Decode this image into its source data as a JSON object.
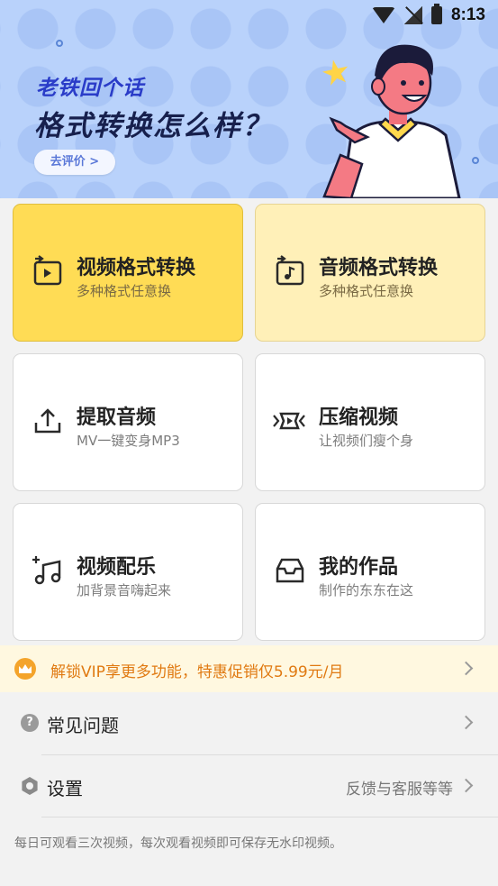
{
  "status_bar": {
    "time": "8:13"
  },
  "banner": {
    "subtitle": "老铁回个话",
    "title": "格式转换怎么样？",
    "button": "去评价 >"
  },
  "cards": [
    {
      "title": "视频格式转换",
      "desc": "多种格式任意换",
      "icon": "video-convert-icon"
    },
    {
      "title": "音频格式转换",
      "desc": "多种格式任意换",
      "icon": "audio-convert-icon"
    },
    {
      "title": "提取音频",
      "desc": "MV一键变身MP3",
      "icon": "upload-icon"
    },
    {
      "title": "压缩视频",
      "desc": "让视频们瘦个身",
      "icon": "compress-icon"
    },
    {
      "title": "视频配乐",
      "desc": "加背景音嗨起来",
      "icon": "music-add-icon"
    },
    {
      "title": "我的作品",
      "desc": "制作的东东在这",
      "icon": "inbox-icon"
    }
  ],
  "vip": {
    "text": "解锁VIP享更多功能，特惠促销仅5.99元/月"
  },
  "rows": {
    "faq": {
      "label": "常见问题"
    },
    "settings": {
      "label": "设置",
      "right": "反馈与客服等等"
    }
  },
  "footer": "每日可观看三次视频，每次观看视频即可保存无水印视频。",
  "colors": {
    "accent_yellow": "#ffdc55",
    "vip_orange": "#e07a12",
    "banner_blue": "#b9d2fb"
  }
}
